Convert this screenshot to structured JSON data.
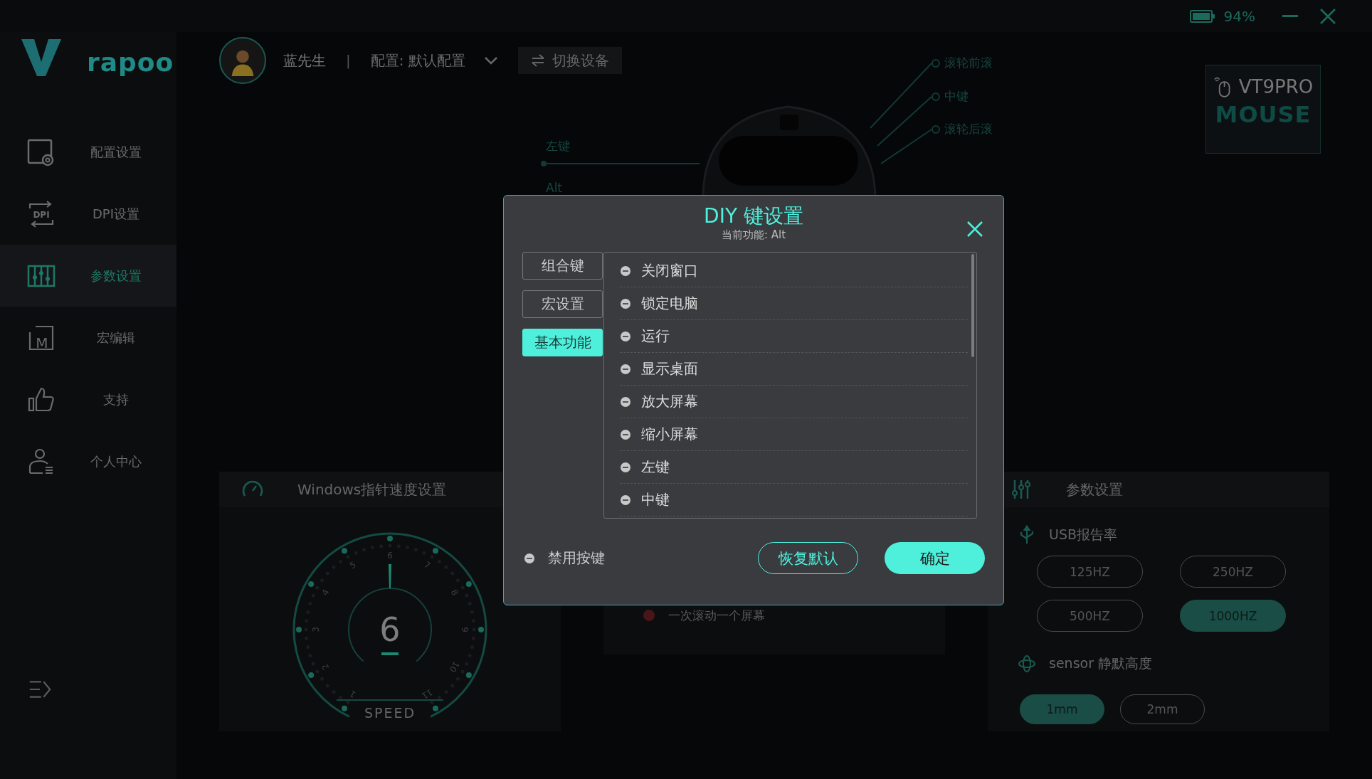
{
  "top_bar": {
    "battery": "94%"
  },
  "logo": {
    "text": "rapoo"
  },
  "sidebar": {
    "items": [
      {
        "label": "配置设置",
        "selected": false
      },
      {
        "label": "DPI设置",
        "icon_text": "DPI",
        "selected": false
      },
      {
        "label": "参数设置",
        "selected": true
      },
      {
        "label": "宏编辑",
        "icon_text": "M",
        "selected": false
      },
      {
        "label": "支持",
        "selected": false
      },
      {
        "label": "个人中心",
        "selected": false
      }
    ]
  },
  "header": {
    "user_name": "蓝先生",
    "separator": "|",
    "profile": "配置: 默认配置",
    "switch_button": "切换设备"
  },
  "mouse_labels": {
    "right": [
      "滚轮前滚",
      "中键",
      "滚轮后滚"
    ],
    "left": [
      "左键",
      "Alt"
    ]
  },
  "device_card": {
    "model": "VT9PRO",
    "type": "MOUSE"
  },
  "pointer_panel": {
    "title": "Windows指针速度设置",
    "ticks": [
      "1",
      "2",
      "3",
      "4",
      "5",
      "6",
      "7",
      "8",
      "9",
      "10",
      "11"
    ],
    "value": "6",
    "caption": "SPEED"
  },
  "scroll_panel": {
    "options": [
      {
        "label": "一次滚动一个屏幕"
      }
    ]
  },
  "params_panel": {
    "title": "参数设置",
    "usb": {
      "label": "USB报告率",
      "options": [
        {
          "label": "125HZ",
          "selected": false
        },
        {
          "label": "250HZ",
          "selected": false
        },
        {
          "label": "500HZ",
          "selected": false
        },
        {
          "label": "1000HZ",
          "selected": true
        }
      ]
    },
    "sensor": {
      "label": "sensor 静默高度",
      "options": [
        {
          "label": "1mm",
          "selected": true
        },
        {
          "label": "2mm",
          "selected": false
        }
      ]
    }
  },
  "dialog": {
    "title": "DIY 键设置",
    "subtitle": "当前功能: Alt",
    "tabs": [
      {
        "label": "组合键",
        "selected": false
      },
      {
        "label": "宏设置",
        "selected": false
      },
      {
        "label": "基本功能",
        "selected": true
      }
    ],
    "functions": [
      "关闭窗口",
      "锁定电脑",
      "运行",
      "显示桌面",
      "放大屏幕",
      "缩小屏幕",
      "左键",
      "中键"
    ],
    "disable": {
      "label": "禁用按键"
    },
    "buttons": [
      {
        "label": "恢复默认",
        "kind": "outline"
      },
      {
        "label": "确定",
        "kind": "primary"
      }
    ]
  }
}
